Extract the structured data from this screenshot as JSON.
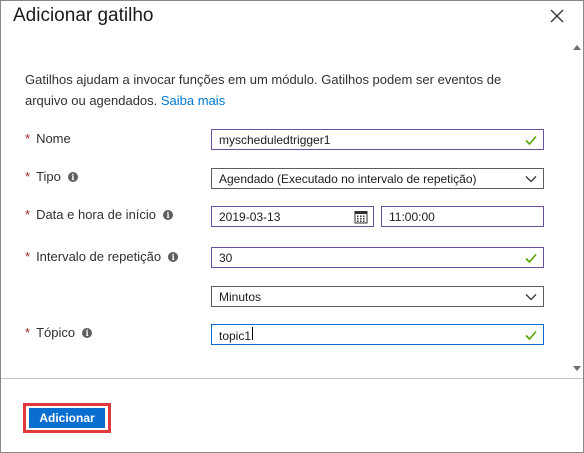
{
  "dialog": {
    "title": "Adicionar gatilho",
    "close_icon": "close-icon"
  },
  "description": {
    "text": "Gatilhos ajudam a invocar funções em um módulo. Gatilhos podem ser eventos de arquivo ou agendados. ",
    "link": "Saiba mais"
  },
  "form": {
    "nome": {
      "label": "Nome",
      "value": "myscheduledtrigger1",
      "valid": true
    },
    "tipo": {
      "label": "Tipo",
      "value": "Agendado (Executado no intervalo de repetição)"
    },
    "data_inicio": {
      "label": "Data e hora de início",
      "date": "2019-03-13",
      "time": "11:00:00"
    },
    "intervalo": {
      "label": "Intervalo de repetição",
      "value": "30",
      "unit": "Minutos"
    },
    "topico": {
      "label": "Tópico",
      "value": "topic1"
    }
  },
  "footer": {
    "add_button": "Adicionar"
  },
  "colors": {
    "accent": "#0a6ed1",
    "required": "#a4262c",
    "valid_check": "#57a300",
    "highlight": "#e03a3e",
    "link": "#0078d4"
  }
}
